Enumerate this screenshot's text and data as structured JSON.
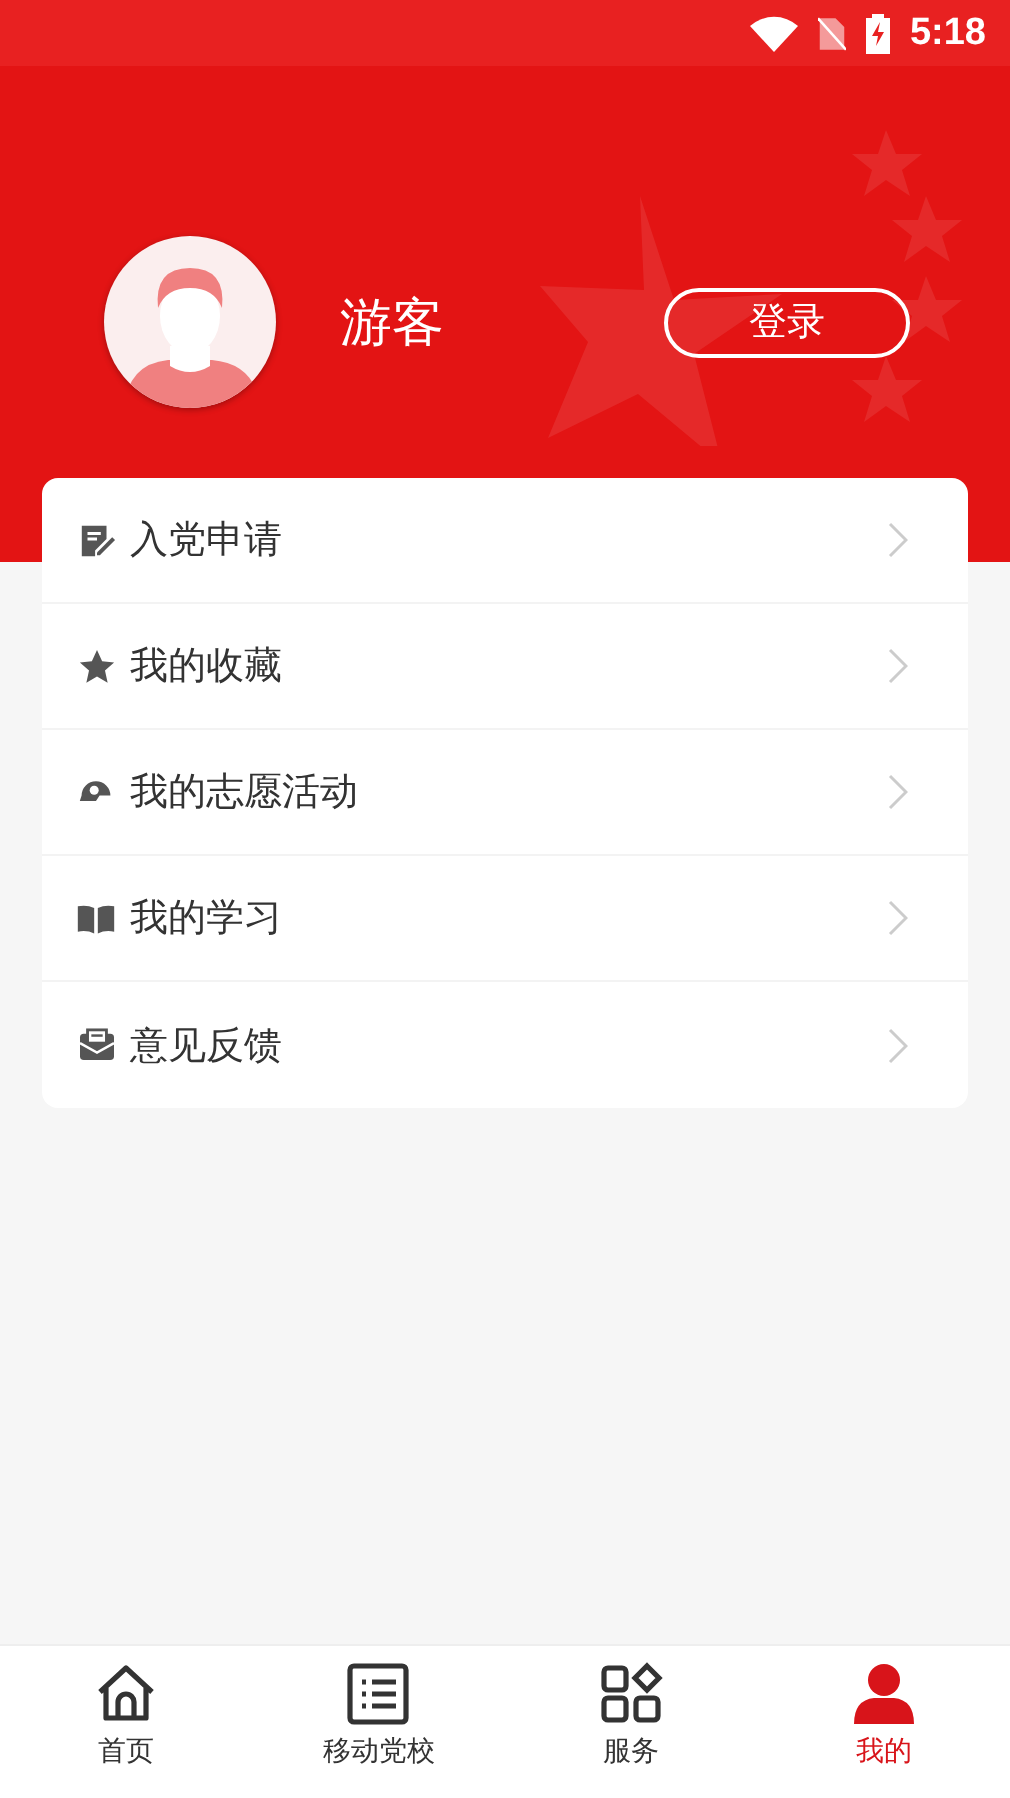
{
  "status_bar": {
    "time": "5:18"
  },
  "profile": {
    "name": "游客",
    "login_button": "登录"
  },
  "menu": [
    {
      "kind": "application",
      "label": "入党申请"
    },
    {
      "kind": "favorites",
      "label": "我的收藏"
    },
    {
      "kind": "volunteer",
      "label": "我的志愿活动"
    },
    {
      "kind": "study",
      "label": "我的学习"
    },
    {
      "kind": "feedback",
      "label": "意见反馈"
    }
  ],
  "tabs": [
    {
      "kind": "home",
      "label": "首页",
      "selected": false
    },
    {
      "kind": "school",
      "label": "移动党校",
      "selected": false
    },
    {
      "kind": "services",
      "label": "服务",
      "selected": false
    },
    {
      "kind": "me",
      "label": "我的",
      "selected": true
    }
  ]
}
